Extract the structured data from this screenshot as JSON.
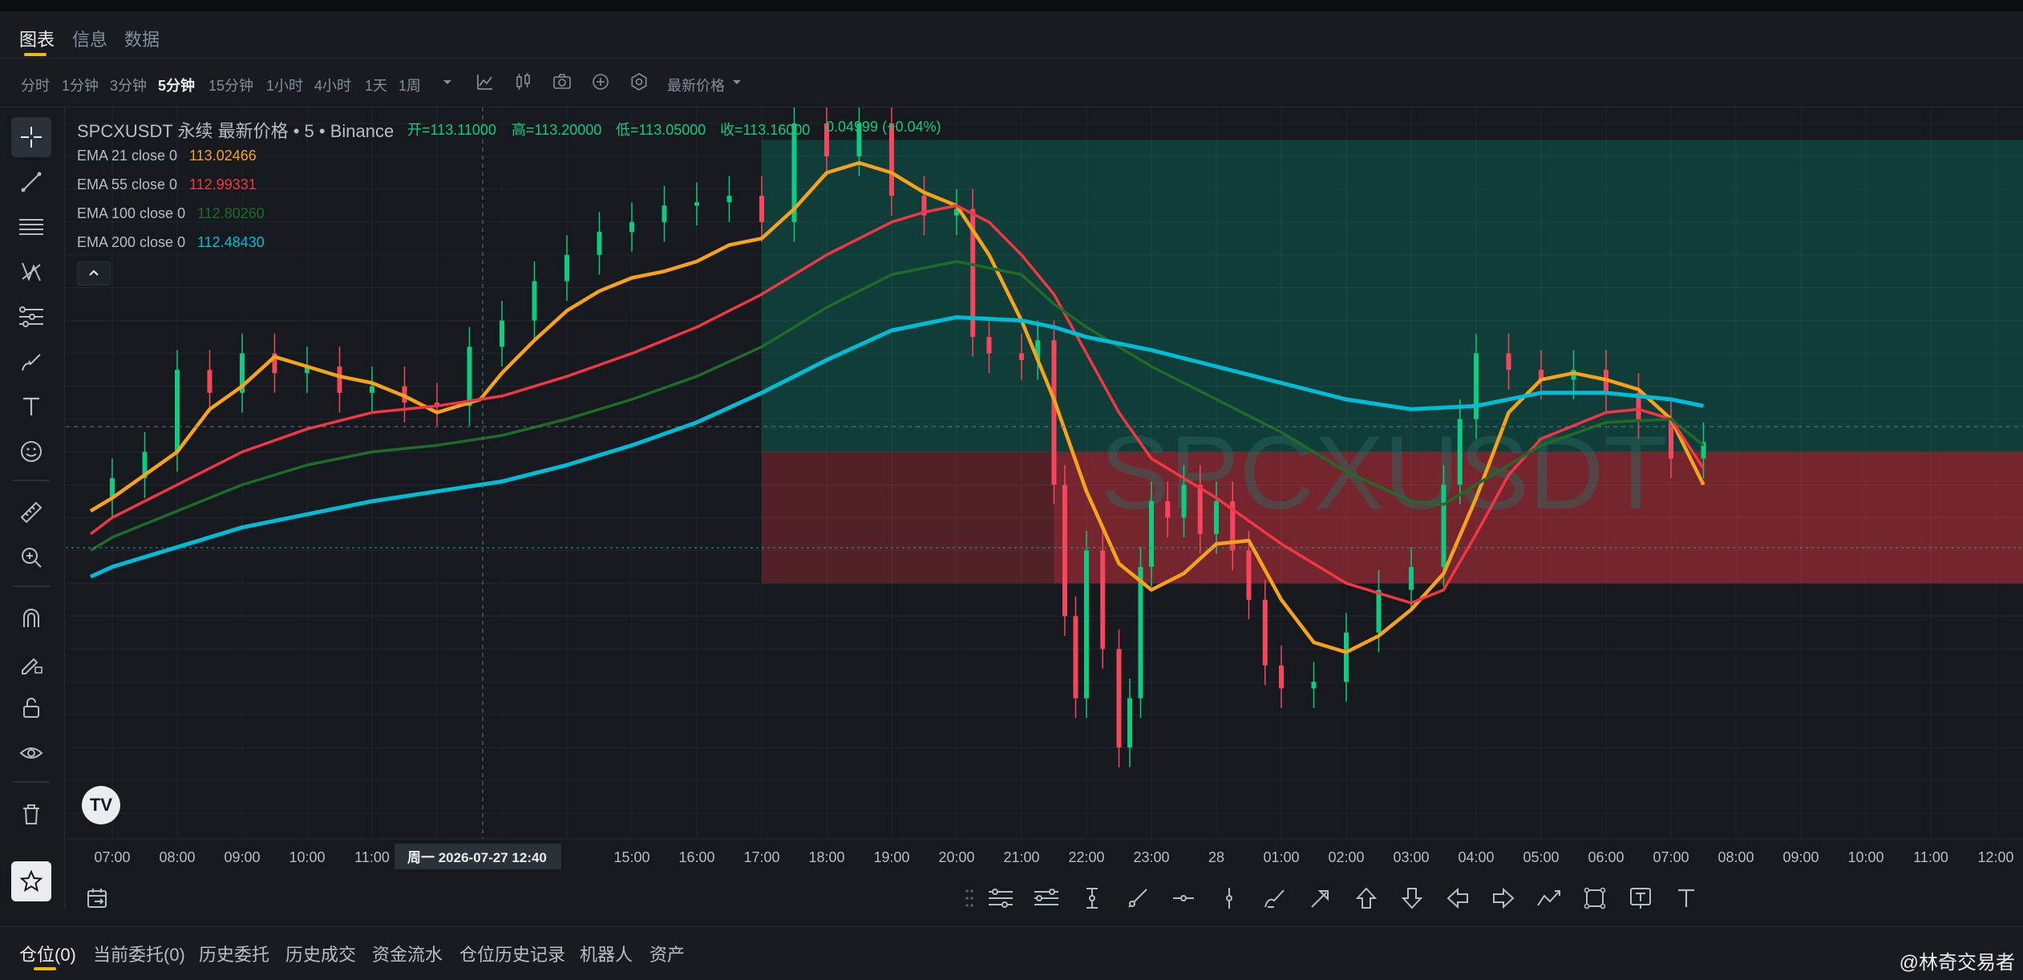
{
  "tabs": {
    "items": [
      {
        "label": "图表",
        "active": true
      },
      {
        "label": "信息",
        "active": false
      },
      {
        "label": "数据",
        "active": false
      }
    ]
  },
  "timeframes": {
    "items": [
      "分时",
      "1分钟",
      "3分钟",
      "5分钟",
      "15分钟",
      "1小时",
      "4小时",
      "1天",
      "1周"
    ],
    "active": "5分钟",
    "price_type": "最新价格"
  },
  "legend": {
    "symbol_line": "SPCXUSDT 永续 最新价格 • 5 • Binance",
    "open": "开=113.11000",
    "high": "高=113.20000",
    "low": "低=113.05000",
    "close": "收=113.16000",
    "change": "0.04999 (+0.04%)",
    "emas": [
      {
        "label": "EMA 21 close 0",
        "value": "113.02466",
        "color": "#f7a21b"
      },
      {
        "label": "EMA 55 close 0",
        "value": "112.99331",
        "color": "#f23645"
      },
      {
        "label": "EMA 100 close 0",
        "value": "112.80260",
        "color": "#1e6b2a"
      },
      {
        "label": "EMA 200 close 0",
        "value": "112.48430",
        "color": "#00bcd4"
      }
    ]
  },
  "chart_data": {
    "type": "line",
    "title": "SPCXUSDT 永续 最新价格 • 5 • Binance",
    "watermark": "SPCXUSDT",
    "x_tick_labels": [
      "07:00",
      "08:00",
      "09:00",
      "10:00",
      "11:00",
      "12:00",
      "15:00",
      "16:00",
      "17:00",
      "18:00",
      "19:00",
      "20:00",
      "21:00",
      "22:00",
      "23:00",
      "28",
      "01:00",
      "02:00",
      "03:00",
      "04:00",
      "05:00",
      "06:00",
      "07:00",
      "08:00",
      "09:00",
      "10:00",
      "11:00",
      "12:00"
    ],
    "crosshair_label": "周一 2026-07-27   12:40",
    "y_range": [
      111.6,
      113.7
    ],
    "grid": true,
    "last_close": 113.16,
    "series": [
      {
        "name": "EMA 21 close 0",
        "color": "#f7a21b",
        "x": [
          "06:40",
          "07:00",
          "08:00",
          "08:30",
          "09:00",
          "09:30",
          "10:00",
          "10:30",
          "11:00",
          "11:30",
          "12:00",
          "12:40",
          "13:00",
          "13:30",
          "14:00",
          "14:30",
          "15:00",
          "15:30",
          "16:00",
          "16:30",
          "17:00",
          "17:30",
          "18:00",
          "18:30",
          "19:00",
          "19:30",
          "20:00",
          "20:30",
          "21:00",
          "21:30",
          "22:00",
          "22:30",
          "23:00",
          "23:30",
          "00:00",
          "00:30",
          "01:00",
          "01:30",
          "02:00",
          "02:30",
          "03:00",
          "03:30",
          "04:00",
          "04:30",
          "05:00",
          "05:30",
          "06:00",
          "06:30",
          "07:00",
          "07:30"
        ],
        "values": [
          112.52,
          112.56,
          112.7,
          112.83,
          112.9,
          112.99,
          112.96,
          112.93,
          112.91,
          112.87,
          112.82,
          112.86,
          112.94,
          113.04,
          113.13,
          113.19,
          113.23,
          113.25,
          113.28,
          113.33,
          113.35,
          113.44,
          113.55,
          113.58,
          113.55,
          113.49,
          113.45,
          113.3,
          113.1,
          112.86,
          112.58,
          112.36,
          112.28,
          112.33,
          112.42,
          112.43,
          112.25,
          112.12,
          112.09,
          112.14,
          112.22,
          112.33,
          112.56,
          112.82,
          112.92,
          112.94,
          112.92,
          112.89,
          112.8,
          112.6
        ]
      },
      {
        "name": "EMA 55 close 0",
        "color": "#f23645",
        "x": [
          "06:40",
          "07:00",
          "08:00",
          "09:00",
          "10:00",
          "11:00",
          "12:00",
          "13:00",
          "14:00",
          "15:00",
          "16:00",
          "17:00",
          "18:00",
          "19:00",
          "19:30",
          "20:00",
          "20:30",
          "21:00",
          "21:30",
          "22:00",
          "22:30",
          "23:00",
          "00:00",
          "01:00",
          "02:00",
          "03:00",
          "03:30",
          "04:00",
          "04:30",
          "05:00",
          "05:30",
          "06:00",
          "06:30",
          "07:00",
          "07:30"
        ],
        "values": [
          112.45,
          112.5,
          112.6,
          112.7,
          112.77,
          112.82,
          112.84,
          112.87,
          112.93,
          113.0,
          113.08,
          113.18,
          113.3,
          113.4,
          113.43,
          113.45,
          113.4,
          113.3,
          113.18,
          113.0,
          112.82,
          112.68,
          112.56,
          112.42,
          112.3,
          112.24,
          112.28,
          112.45,
          112.63,
          112.74,
          112.78,
          112.82,
          112.83,
          112.8,
          112.65
        ]
      },
      {
        "name": "EMA 100 close 0",
        "color": "#1e6b2a",
        "x": [
          "06:40",
          "07:00",
          "08:00",
          "09:00",
          "10:00",
          "11:00",
          "12:00",
          "13:00",
          "14:00",
          "15:00",
          "16:00",
          "17:00",
          "18:00",
          "19:00",
          "20:00",
          "21:00",
          "21:30",
          "22:00",
          "23:00",
          "00:00",
          "01:00",
          "02:00",
          "03:00",
          "03:30",
          "04:00",
          "05:00",
          "06:00",
          "07:00",
          "07:30"
        ],
        "values": [
          112.4,
          112.44,
          112.52,
          112.6,
          112.66,
          112.7,
          112.72,
          112.75,
          112.8,
          112.86,
          112.93,
          113.02,
          113.14,
          113.24,
          113.28,
          113.24,
          113.15,
          113.08,
          112.96,
          112.86,
          112.76,
          112.64,
          112.55,
          112.54,
          112.6,
          112.72,
          112.79,
          112.8,
          112.72
        ]
      },
      {
        "name": "EMA 200 close 0",
        "color": "#00bcd4",
        "x": [
          "06:40",
          "07:00",
          "08:00",
          "09:00",
          "10:00",
          "11:00",
          "12:00",
          "13:00",
          "14:00",
          "15:00",
          "16:00",
          "17:00",
          "18:00",
          "19:00",
          "20:00",
          "21:00",
          "21:30",
          "22:00",
          "23:00",
          "00:00",
          "01:00",
          "02:00",
          "03:00",
          "04:00",
          "05:00",
          "06:00",
          "07:00",
          "07:30"
        ],
        "values": [
          112.32,
          112.35,
          112.41,
          112.47,
          112.51,
          112.55,
          112.58,
          112.61,
          112.66,
          112.72,
          112.79,
          112.88,
          112.98,
          113.07,
          113.11,
          113.1,
          113.08,
          113.05,
          113.01,
          112.96,
          112.91,
          112.86,
          112.83,
          112.84,
          112.88,
          112.88,
          112.86,
          112.84
        ]
      }
    ],
    "candles": {
      "x": [
        "06:40",
        "07:00",
        "07:30",
        "08:00",
        "08:30",
        "09:00",
        "09:30",
        "10:00",
        "10:30",
        "11:00",
        "11:30",
        "12:00",
        "12:30",
        "13:00",
        "13:30",
        "14:00",
        "14:30",
        "15:00",
        "15:30",
        "16:00",
        "16:30",
        "17:00",
        "17:30",
        "18:00",
        "18:30",
        "19:00",
        "19:30",
        "20:00",
        "20:15",
        "20:30",
        "21:00",
        "21:15",
        "21:30",
        "21:40",
        "21:50",
        "22:00",
        "22:15",
        "22:30",
        "22:40",
        "22:50",
        "23:00",
        "23:15",
        "23:30",
        "23:45",
        "00:00",
        "00:15",
        "00:30",
        "00:45",
        "01:00",
        "01:30",
        "02:00",
        "02:30",
        "03:00",
        "03:30",
        "03:45",
        "04:00",
        "04:30",
        "05:00",
        "05:30",
        "06:00",
        "06:30",
        "07:00",
        "07:30"
      ],
      "close": [
        112.56,
        112.62,
        112.7,
        112.95,
        112.88,
        113.0,
        112.94,
        112.96,
        112.88,
        112.9,
        112.85,
        112.84,
        113.02,
        113.1,
        113.22,
        113.3,
        113.37,
        113.4,
        113.45,
        113.46,
        113.48,
        113.4,
        113.7,
        113.6,
        113.7,
        113.48,
        113.42,
        113.44,
        113.05,
        113.0,
        112.98,
        113.04,
        112.6,
        112.2,
        111.95,
        112.4,
        112.1,
        111.8,
        111.95,
        112.35,
        112.55,
        112.5,
        112.6,
        112.45,
        112.55,
        112.4,
        112.25,
        112.05,
        111.98,
        112.0,
        112.15,
        112.28,
        112.35,
        112.6,
        112.8,
        113.0,
        112.95,
        112.92,
        112.95,
        112.88,
        112.8,
        112.68,
        112.73
      ]
    },
    "position_zones": [
      {
        "name": "profit",
        "color": "#089981",
        "from_time": "17:00",
        "y_range": [
          112.7,
          113.65
        ]
      },
      {
        "name": "loss",
        "color": "#f23645",
        "from_time": "17:00",
        "y_range": [
          112.3,
          112.7
        ]
      },
      {
        "name": "loss-dark",
        "color": "#f23645",
        "from_time": "21:30",
        "y_range": [
          112.3,
          112.7
        ]
      }
    ]
  },
  "left_tools": [
    "crosshair-icon",
    "trend-line-icon",
    "horizontal-lines-icon",
    "pattern-icon",
    "fib-icon",
    "brush-icon",
    "text-icon",
    "emoji-icon",
    "ruler-icon",
    "zoom-in-icon",
    "magnet-icon",
    "lock-drawing-icon",
    "unlock-icon",
    "eye-icon",
    "trash-icon",
    "star-icon"
  ],
  "bottom_tools": [
    "parallel-channel-icon",
    "fib-channel-icon",
    "price-range-icon",
    "ray-line-icon",
    "horizontal-ray-icon",
    "vertical-line-icon",
    "brush-icon",
    "arrow-marker-icon",
    "arrow-up-icon",
    "arrow-down-icon",
    "arrow-left-icon",
    "arrow-right-icon",
    "path-icon",
    "rectangle-icon",
    "text-box-icon",
    "text-icon"
  ],
  "position_tabs": {
    "items": [
      {
        "label": "仓位(0)",
        "active": true
      },
      {
        "label": "当前委托(0)",
        "active": false
      },
      {
        "label": "历史委托",
        "active": false
      },
      {
        "label": "历史成交",
        "active": false
      },
      {
        "label": "资金流水",
        "active": false
      },
      {
        "label": "仓位历史记录",
        "active": false
      },
      {
        "label": "机器人",
        "active": false
      },
      {
        "label": "资产",
        "active": false
      }
    ]
  },
  "author": "@林奇交易者",
  "logo_text": "TV",
  "colors": {
    "accent": "#f0b90b",
    "up": "#0ecb81",
    "down": "#f6465d",
    "bg": "#161a1e"
  }
}
